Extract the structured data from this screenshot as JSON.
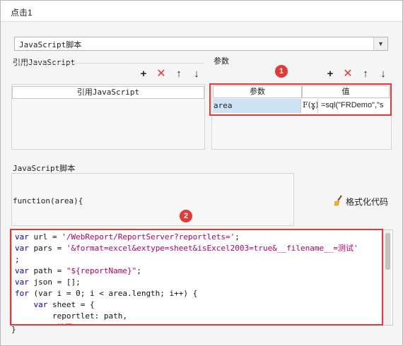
{
  "window": {
    "title": "点击1"
  },
  "action_type": {
    "selected": "JavaScript脚本"
  },
  "ref_js": {
    "label": "引用JavaScript",
    "column_header": "引用JavaScript",
    "toolbar": {
      "add": "+",
      "delete": "✕",
      "up": "↑",
      "down": "↓"
    }
  },
  "params": {
    "label": "参数",
    "headers": [
      "参数",
      "值"
    ],
    "rows": [
      {
        "name": "area",
        "formula_icon": "F(x)",
        "value": "=sql(\"FRDemo\",\"s"
      }
    ],
    "toolbar": {
      "add": "+",
      "delete": "✕",
      "up": "↑",
      "down": "↓"
    }
  },
  "script": {
    "label": "JavaScript脚本",
    "signature": "function(area){",
    "format_button": "格式化代码",
    "closing": "}",
    "lines": [
      {
        "kw": "var",
        "rest": " url = ",
        "str": "'/WebReport/ReportServer?reportlets='",
        "tail": ";"
      },
      {
        "kw": "var",
        "rest": " pars = ",
        "str": "'&format=excel&extype=sheet&isExcel2003=true&__filename__=测试'",
        "tail": ""
      },
      {
        "kw": "",
        "rest": ";",
        "str": "",
        "tail": ""
      },
      {
        "kw": "var",
        "rest": " path = ",
        "str": "\"${reportName}\"",
        "tail": ";"
      },
      {
        "kw": "var",
        "rest": " json = [];",
        "str": "",
        "tail": ""
      },
      {
        "kw": "for",
        "rest": " (var i = 0; i < area.length; i++) {",
        "str": "",
        "tail": ""
      },
      {
        "kw": "    var",
        "rest": " sheet = {",
        "str": "",
        "tail": ""
      },
      {
        "kw": "",
        "rest": "        reportlet: path,",
        "str": "",
        "tail": ""
      },
      {
        "kw": "",
        "rest": "        ",
        "str": "\"地区\"",
        "tail": ": area[i]"
      }
    ]
  },
  "callouts": {
    "one": "1",
    "two": "2"
  },
  "colors": {
    "accent_red": "#e53935",
    "keyword": "#0000cc",
    "string": "#b0006a",
    "selected_row": "#cfe3f7"
  }
}
